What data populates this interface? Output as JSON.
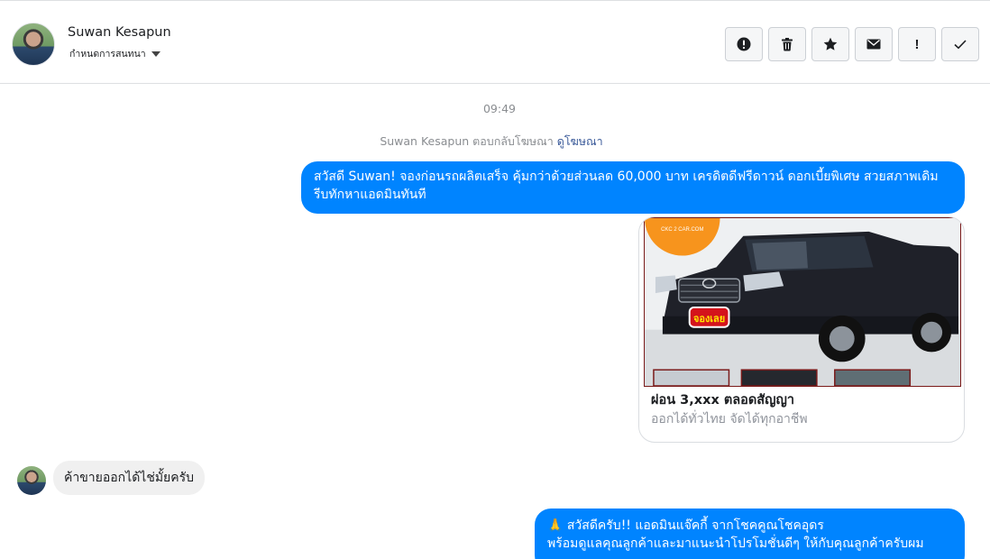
{
  "header": {
    "name": "Suwan Kesapun",
    "subtitle": "กำหนดการสนทนา",
    "actions": [
      {
        "icon": "alert-circle-icon",
        "label": ""
      },
      {
        "icon": "trash-icon",
        "label": ""
      },
      {
        "icon": "star-icon",
        "label": ""
      },
      {
        "icon": "envelope-icon",
        "label": ""
      },
      {
        "icon": "exclamation-icon",
        "label": "!"
      },
      {
        "icon": "checkmark-icon",
        "label": ""
      }
    ]
  },
  "conversation": {
    "timestamp": "09:49",
    "ad_reply_text": "Suwan Kesapun ตอบกลับโฆษณา",
    "ad_reply_link": "ดูโฆษณา",
    "messages": [
      {
        "from": "page",
        "text": "สวัสดี Suwan! จองก่อนรถผลิตเสร็จ คุ้มกว่าด้วยส่วนลด 60,000 บาท เครดิตดีฟรีดาวน์ ดอกเบี้ยพิเศษ สวยสภาพเดิม รีบทักหาแอดมินทันที"
      },
      {
        "from": "page",
        "type": "card",
        "title": "ผ่อน 3,xxx ตลอดสัญญา",
        "subtitle": "ออกได้ทั่วไทย จัดได้ทุกอาชีพ",
        "image_badge": "จองเลย",
        "image_logo": "CKC 2 CAR.COM"
      },
      {
        "from": "user",
        "text": "ค้าขายออกได้ไช่มั้ยครับ"
      },
      {
        "from": "page",
        "line1": "🙏 สวัสดีครับ!! แอดมินแจ๊คกี้ จากโชคคูณโชคอุดร",
        "line2": "พร้อมดูแลคุณลูกค้าและมาแนะนำโปรโมชั่นดีๆ ให้กับคุณลูกค้าครับผม"
      }
    ]
  },
  "colors": {
    "outgoing_bubble": "#0084ff",
    "incoming_bubble": "#f0f0f0",
    "link": "#385898"
  }
}
